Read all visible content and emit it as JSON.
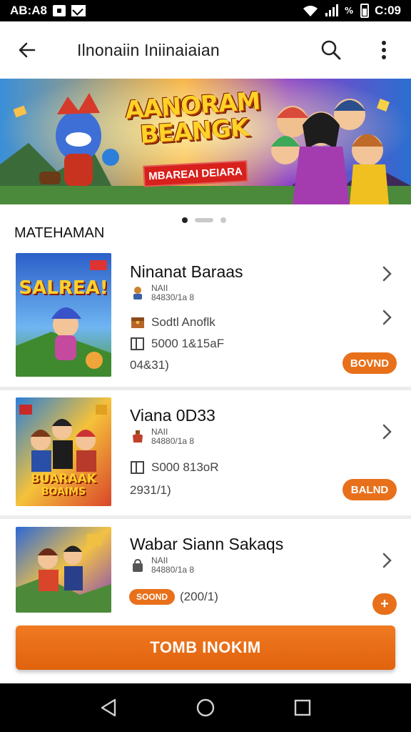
{
  "status_bar": {
    "time": "AB:A8",
    "clock": "C:09"
  },
  "app_bar": {
    "title": "Ilnonaiin Iniinaiaian"
  },
  "banner": {
    "title_line1": "AANORAM",
    "title_line2": "BEANGK",
    "subtitle": "MBAREAI DEIARA",
    "slide_count": 3,
    "active_slide": 1
  },
  "section": {
    "title": "MATEHAMAN"
  },
  "items": [
    {
      "thumb_text": "SALREA!",
      "title": "Ninanat Baraas",
      "meta_small_1": "NAII",
      "meta_small_2": "84830/1a 8",
      "meta_line_1": "Sodtl Anoflk",
      "meta_line_2": "5000 1&15aF",
      "meta_line_3": "04&31)",
      "pill": "BOVND"
    },
    {
      "thumb_text": "BUARAAK",
      "thumb_text_2": "BOAIMS",
      "title": "Viana 0D33",
      "meta_small_1": "NAII",
      "meta_small_2": "84880/1a 8",
      "meta_line_2": "S000 813oR",
      "meta_line_3": "2931/1)",
      "pill": "BALND"
    },
    {
      "title": "Wabar Siann Sakaqs",
      "meta_small_1": "NAII",
      "meta_small_2": "84880/1a 8",
      "pill": "SOOND",
      "meta_line_3": "(200/1)",
      "plus": "+"
    }
  ],
  "cta": {
    "label": "TOMB INOKIM"
  },
  "colors": {
    "accent": "#e8701a",
    "status_bg": "#000000"
  }
}
